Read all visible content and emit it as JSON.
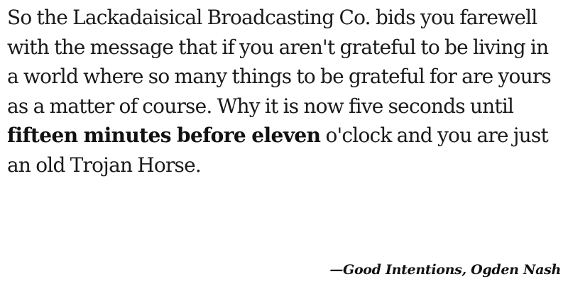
{
  "quote": {
    "text_before": "So the Lackadaisical Broadcasting Co. bids you farewell with the message that if you aren't grateful to be living in a world where so many things to be grateful for are yours as a matter of course. Why it is now five seconds until ",
    "emphasis": "fifteen minutes before eleven",
    "text_after": " o'clock and you are just an old Trojan Horse."
  },
  "attribution": "—Good Intentions, Ogden Nash"
}
